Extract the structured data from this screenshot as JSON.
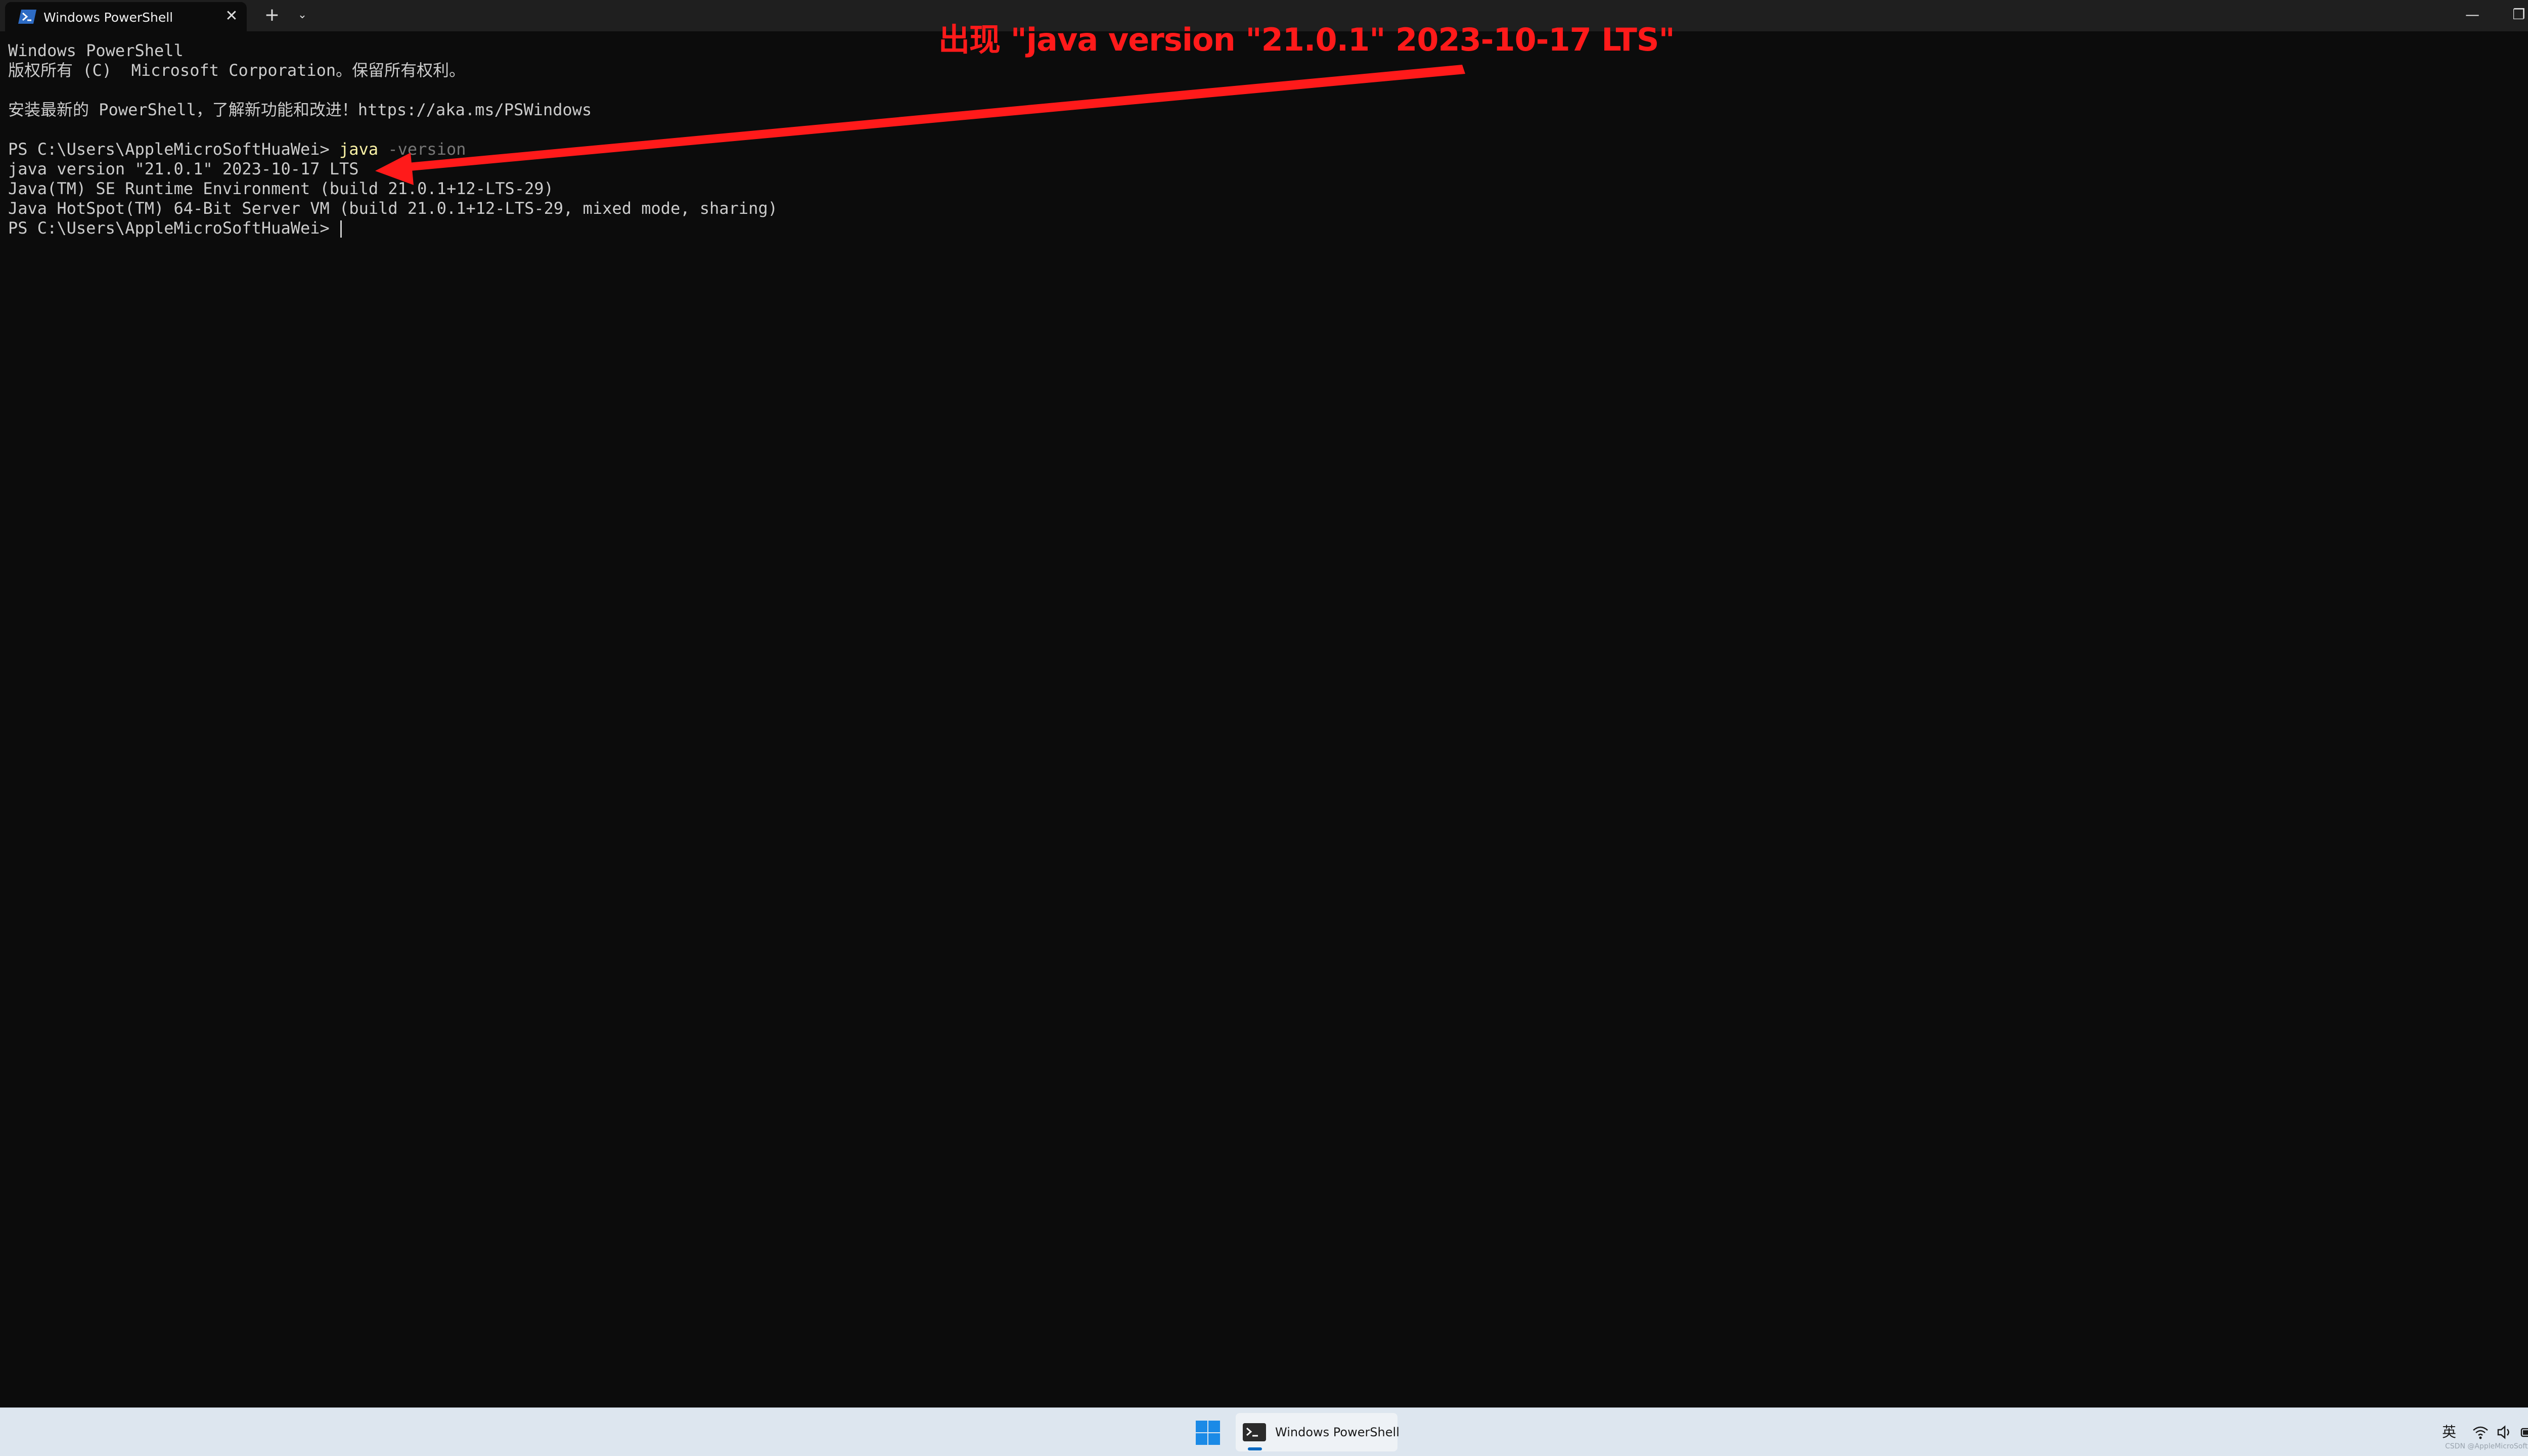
{
  "window": {
    "tab_title": "Windows PowerShell",
    "tab_close": "✕",
    "new_tab": "+",
    "tab_dropdown": "⌄",
    "minimize": "—",
    "maximize": "❐",
    "close": "✕"
  },
  "terminal": {
    "line1": "Windows PowerShell",
    "line2": "版权所有 (C)  Microsoft Corporation。保留所有权利。",
    "line3": "安装最新的 PowerShell，了解新功能和改进！https://aka.ms/PSWindows",
    "prompt1": "PS C:\\Users\\AppleMicroSoftHuaWei> ",
    "command": "java",
    "param": " -version",
    "out1": "java version \"21.0.1\" 2023-10-17 LTS",
    "out2": "Java(TM) SE Runtime Environment (build 21.0.1+12-LTS-29)",
    "out3": "Java HotSpot(TM) 64-Bit Server VM (build 21.0.1+12-LTS-29, mixed mode, sharing)",
    "prompt2": "PS C:\\Users\\AppleMicroSoftHuaWei> "
  },
  "annotation": {
    "text": "出现 \"java version \"21.0.1\" 2023-10-17 LTS\"",
    "color": "#ff1a1a"
  },
  "taskbar": {
    "app_label": "Windows PowerShell",
    "ime": "英",
    "watermark": "CSDN @AppleMicroSoftHuaWei",
    "accent": "#0067c0"
  }
}
